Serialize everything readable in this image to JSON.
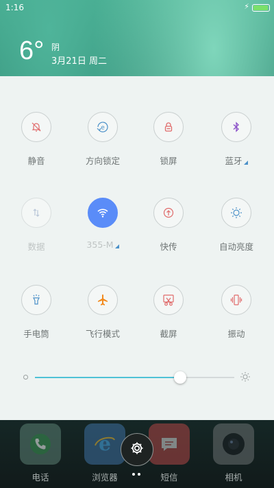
{
  "status_bar": {
    "time": "1:16",
    "battery_level": 0.95
  },
  "weather": {
    "temperature": "6°",
    "condition": "阴",
    "date": "3月21日 周二"
  },
  "toggles": [
    {
      "label": "静音",
      "icon": "bell-off-icon"
    },
    {
      "label": "方向锁定",
      "icon": "rotation-lock-icon"
    },
    {
      "label": "锁屏",
      "icon": "lock-icon"
    },
    {
      "label": "蓝牙",
      "icon": "bluetooth-icon"
    },
    {
      "label": "数据",
      "icon": "mobile-data-icon"
    },
    {
      "label": "355-M",
      "icon": "wifi-icon"
    },
    {
      "label": "快传",
      "icon": "quick-transfer-icon"
    },
    {
      "label": "自动亮度",
      "icon": "auto-brightness-icon"
    },
    {
      "label": "手电筒",
      "icon": "flashlight-icon"
    },
    {
      "label": "飞行模式",
      "icon": "airplane-icon"
    },
    {
      "label": "截屏",
      "icon": "screenshot-icon"
    },
    {
      "label": "振动",
      "icon": "vibrate-icon"
    }
  ],
  "brightness": {
    "level": 0.73
  },
  "dock": [
    {
      "label": "电话",
      "icon": "phone-icon"
    },
    {
      "label": "浏览器",
      "icon": "browser-icon"
    },
    {
      "label": "短信",
      "icon": "messages-icon"
    },
    {
      "label": "相机",
      "icon": "camera-icon"
    }
  ],
  "colors": {
    "accent": "#5a8cf8",
    "slider_fill": "#4fc1d6",
    "icon_red": "#e06a6a",
    "icon_blue": "#4a90c8"
  }
}
